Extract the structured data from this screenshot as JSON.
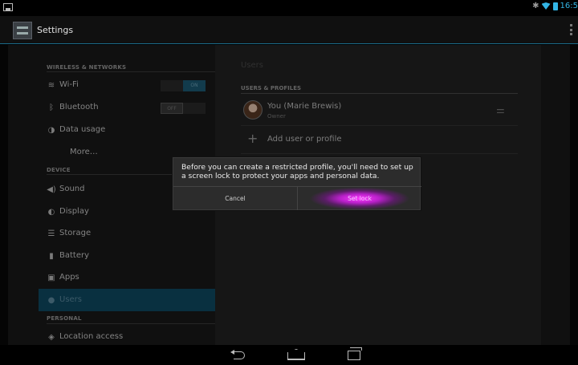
{
  "status_bar": {
    "time": "16:5",
    "icons": [
      "notification-icon",
      "bluetooth-icon",
      "wifi-icon",
      "battery-icon"
    ]
  },
  "action_bar": {
    "title": "Settings",
    "icon": "settings-app-icon",
    "overflow_icon": "overflow-menu-icon"
  },
  "left_pane": {
    "sections": [
      {
        "header": "WIRELESS & NETWORKS",
        "items": [
          {
            "label": "Wi-Fi",
            "icon": "wifi-icon",
            "toggle": "ON"
          },
          {
            "label": "Bluetooth",
            "icon": "bluetooth-icon",
            "toggle": "OFF"
          },
          {
            "label": "Data usage",
            "icon": "data-usage-icon"
          },
          {
            "label": "More…",
            "icon": ""
          }
        ]
      },
      {
        "header": "DEVICE",
        "items": [
          {
            "label": "Sound",
            "icon": "sound-icon"
          },
          {
            "label": "Display",
            "icon": "display-icon"
          },
          {
            "label": "Storage",
            "icon": "storage-icon"
          },
          {
            "label": "Battery",
            "icon": "battery-icon"
          },
          {
            "label": "Apps",
            "icon": "apps-icon"
          },
          {
            "label": "Users",
            "icon": "users-icon",
            "active": true
          }
        ]
      },
      {
        "header": "PERSONAL",
        "items": [
          {
            "label": "Location access",
            "icon": "location-icon"
          }
        ]
      }
    ]
  },
  "right_pane": {
    "title": "Users",
    "section_header": "USERS & PROFILES",
    "user": {
      "name": "You (Marie Brewis)",
      "role": "Owner"
    },
    "add_label": "Add user or profile"
  },
  "dialog": {
    "message": "Before you can create a restricted profile, you'll need to set up a screen lock to protect your apps and personal data.",
    "cancel_label": "Cancel",
    "confirm_label": "Set lock",
    "highlight_color": "#ff3dff"
  },
  "nav_bar": {
    "icons": [
      "back-icon",
      "home-icon",
      "recent-apps-icon"
    ]
  },
  "colors": {
    "accent": "#33b5e5",
    "active_row": "#0e4a63"
  }
}
